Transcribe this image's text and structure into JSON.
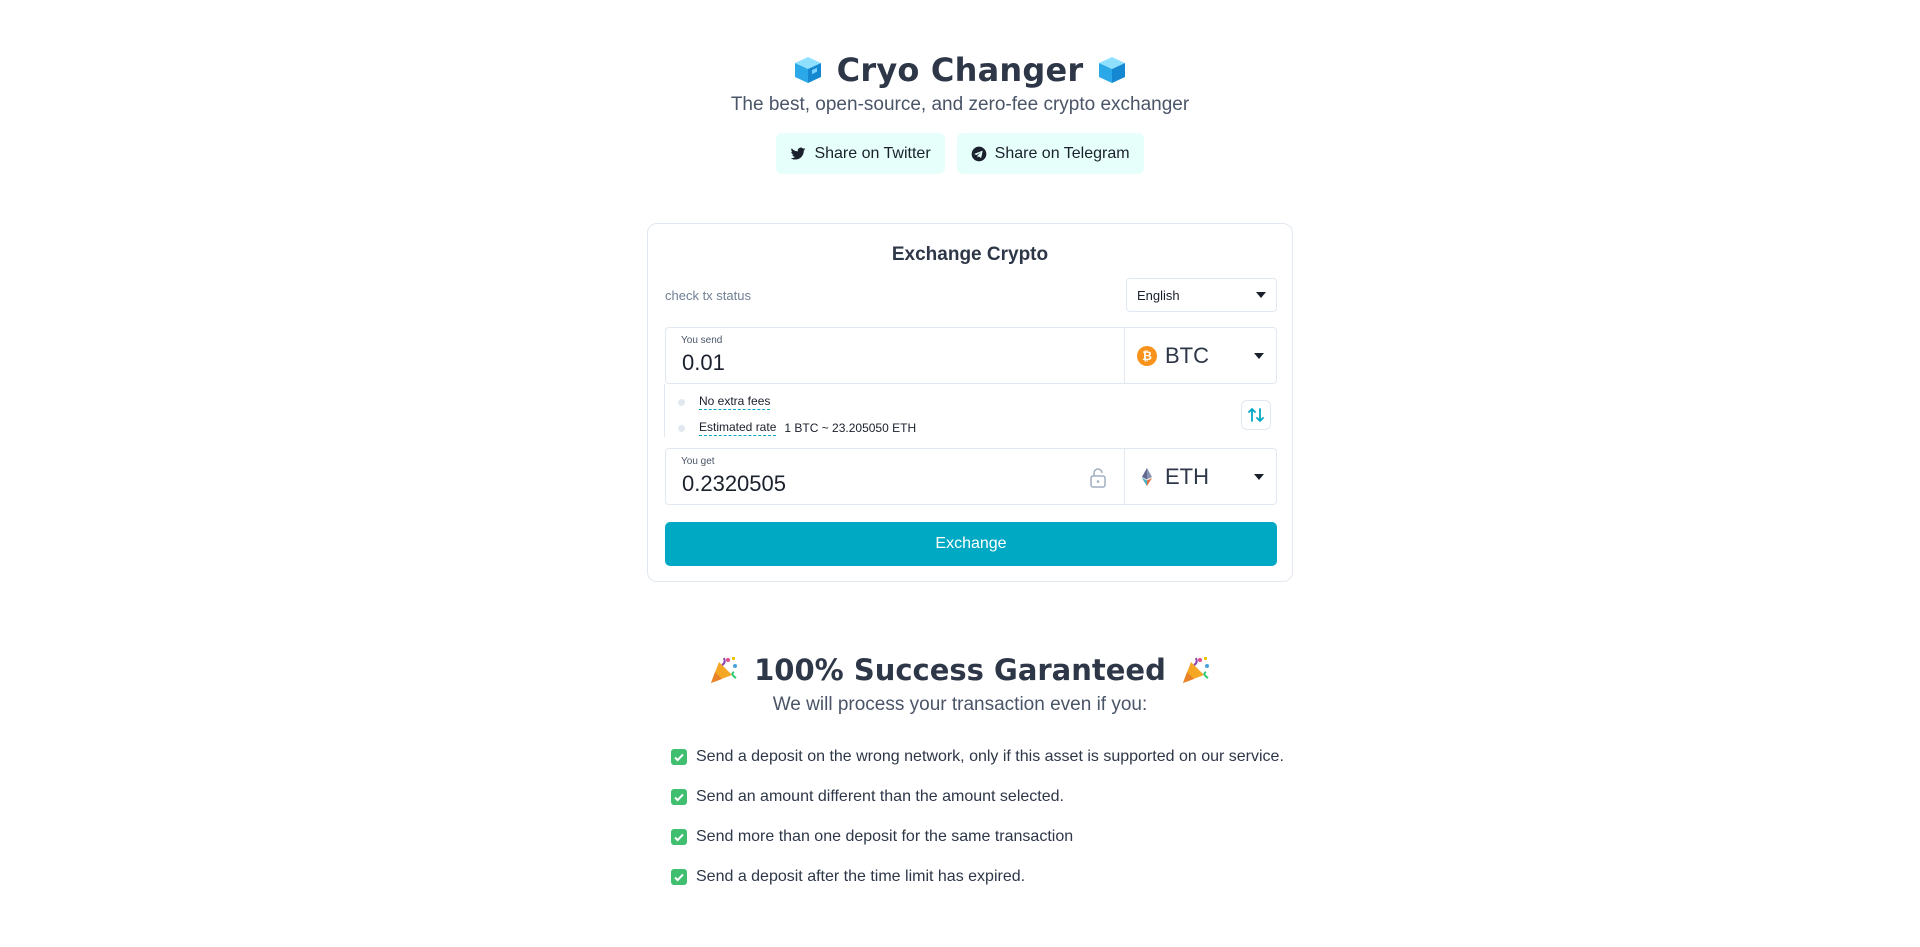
{
  "header": {
    "title": "Cryo Changer",
    "subtitle": "The best, open-source, and zero-fee crypto exchanger",
    "icon": "cube-icon"
  },
  "share": {
    "twitter_label": "Share on Twitter",
    "telegram_label": "Share on Telegram"
  },
  "exchange": {
    "title": "Exchange Crypto",
    "check_status_label": "check tx status",
    "language": "English",
    "send": {
      "label": "You send",
      "value": "0.01",
      "coin": "BTC",
      "coin_icon_glyph": "₿"
    },
    "info": {
      "fees_label": "No extra fees",
      "rate_label": "Estimated rate",
      "rate_value": "1 BTC ~ 23.205050 ETH"
    },
    "get": {
      "label": "You get",
      "value": "0.2320505",
      "coin": "ETH"
    },
    "button_label": "Exchange",
    "accent_color": "#00a9c3"
  },
  "success": {
    "title": "100% Success Garanteed",
    "subtitle": "We will process your transaction even if you:",
    "items": [
      "Send a deposit on the wrong network, only if this asset is supported on our service.",
      "Send an amount different than the amount selected.",
      "Send more than one deposit for the same transaction",
      "Send a deposit after the time limit has expired."
    ]
  }
}
